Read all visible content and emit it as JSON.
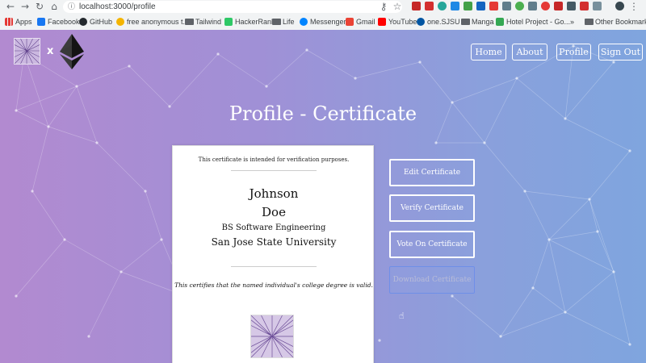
{
  "browser": {
    "url": "localhost:3000/profile",
    "bookmarks": [
      {
        "label": "Apps",
        "color": "#e53935"
      },
      {
        "label": "Facebook",
        "color": "#1877f2"
      },
      {
        "label": "GitHub",
        "color": "#24292e"
      },
      {
        "label": "free anonymous t...",
        "color": "#f4b400"
      },
      {
        "label": "Tailwind",
        "color": "#5f6368"
      },
      {
        "label": "HackerRank",
        "color": "#2ec866"
      },
      {
        "label": "Life",
        "color": "#5f6368"
      },
      {
        "label": "Messenger",
        "color": "#0084ff"
      },
      {
        "label": "Gmail",
        "color": "#ea4335"
      },
      {
        "label": "YouTube",
        "color": "#ff0000"
      },
      {
        "label": "one.SJSU",
        "color": "#0055a2"
      },
      {
        "label": "Manga",
        "color": "#5f6368"
      },
      {
        "label": "Hotel Project - Go...",
        "color": "#34a853"
      },
      {
        "label": "»",
        "color": ""
      },
      {
        "label": "Other Bookmarks",
        "color": "#5f6368"
      }
    ]
  },
  "header": {
    "separator": "x",
    "nav": [
      "Home",
      "About",
      "Profile",
      "Sign Out"
    ]
  },
  "main": {
    "title": "Profile - Certificate",
    "certificate": {
      "note": "This certificate is intended for verification purposes.",
      "first_name": "Johnson",
      "last_name": "Doe",
      "degree": "BS Software Engineering",
      "university": "San Jose State University",
      "statement": "This certifies that the named individual's college degree is valid."
    },
    "actions": [
      "Edit Certificate",
      "Verify Certificate",
      "Vote On Certificate",
      "Download Certificate"
    ]
  }
}
